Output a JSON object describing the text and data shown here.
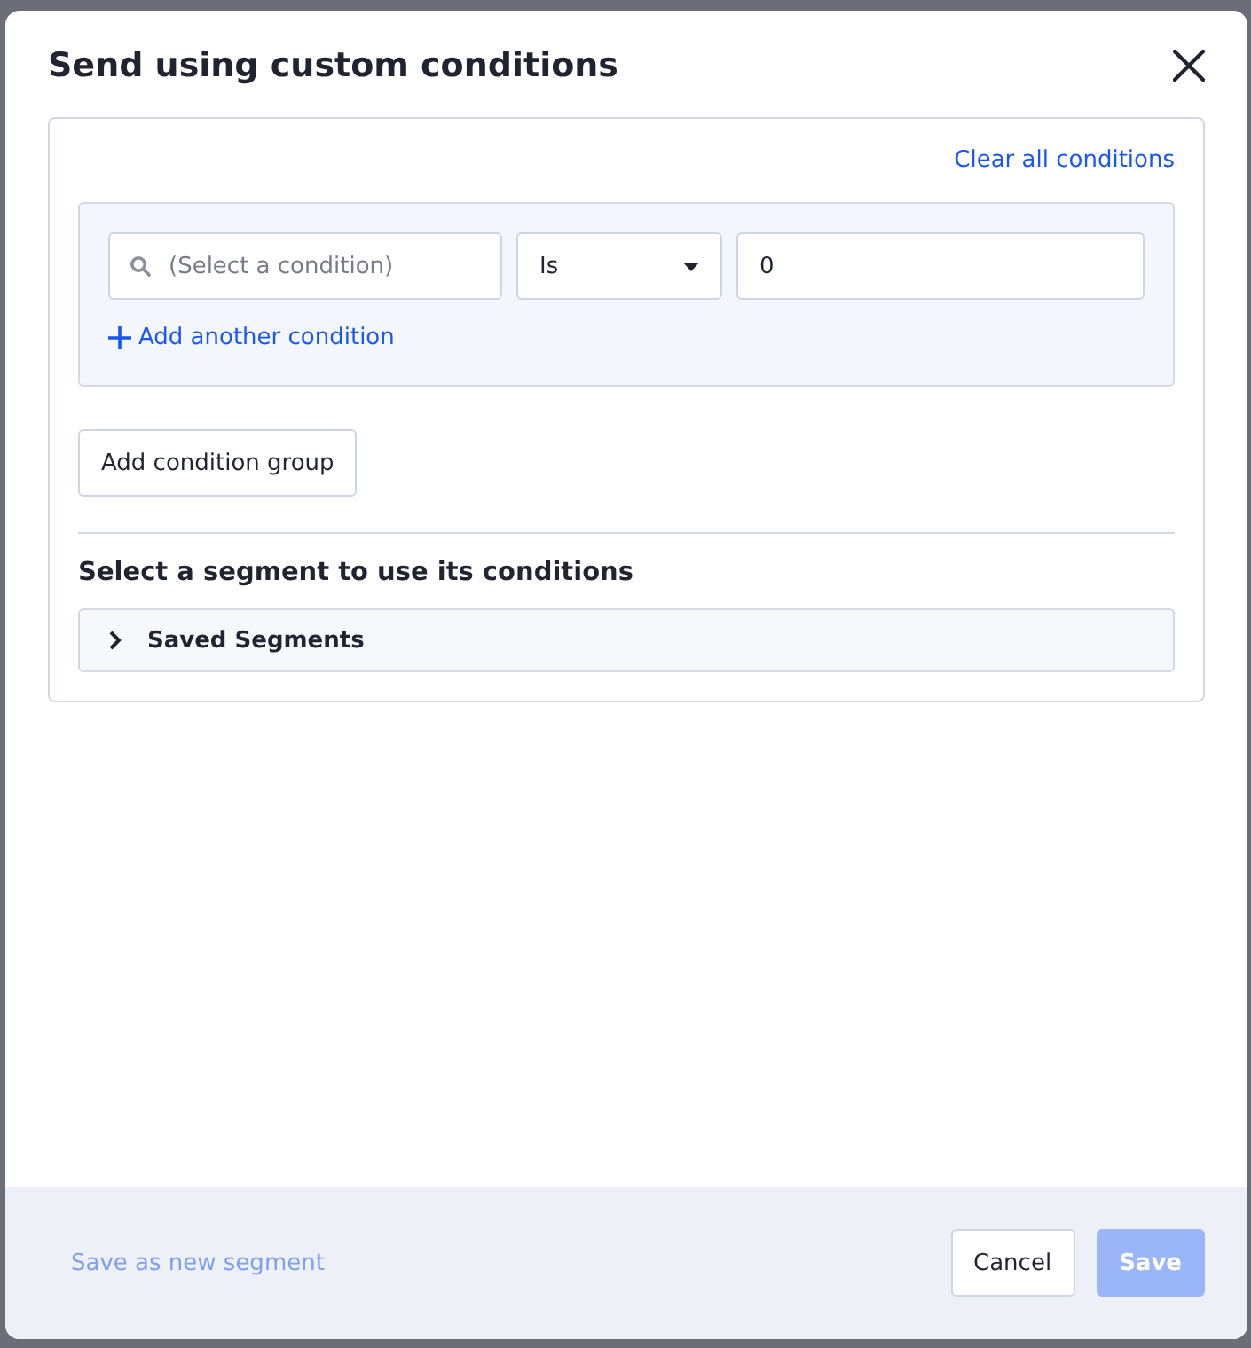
{
  "dialog": {
    "title": "Send using custom conditions"
  },
  "conditions": {
    "clear_all": "Clear all conditions",
    "rows": [
      {
        "field": {
          "placeholder": "(Select a condition)"
        },
        "operator": "Is",
        "value": "0"
      }
    ],
    "add_condition": "Add another condition"
  },
  "add_group_button": "Add condition group",
  "segment_section": {
    "heading": "Select a segment to use its conditions",
    "accordion": {
      "label": "Saved Segments",
      "expanded": false
    }
  },
  "footer": {
    "save_segment": {
      "label": "Save as new segment",
      "disabled": true
    },
    "cancel": {
      "label": "Cancel",
      "disabled": false
    },
    "save": {
      "label": "Save",
      "disabled": true
    }
  }
}
